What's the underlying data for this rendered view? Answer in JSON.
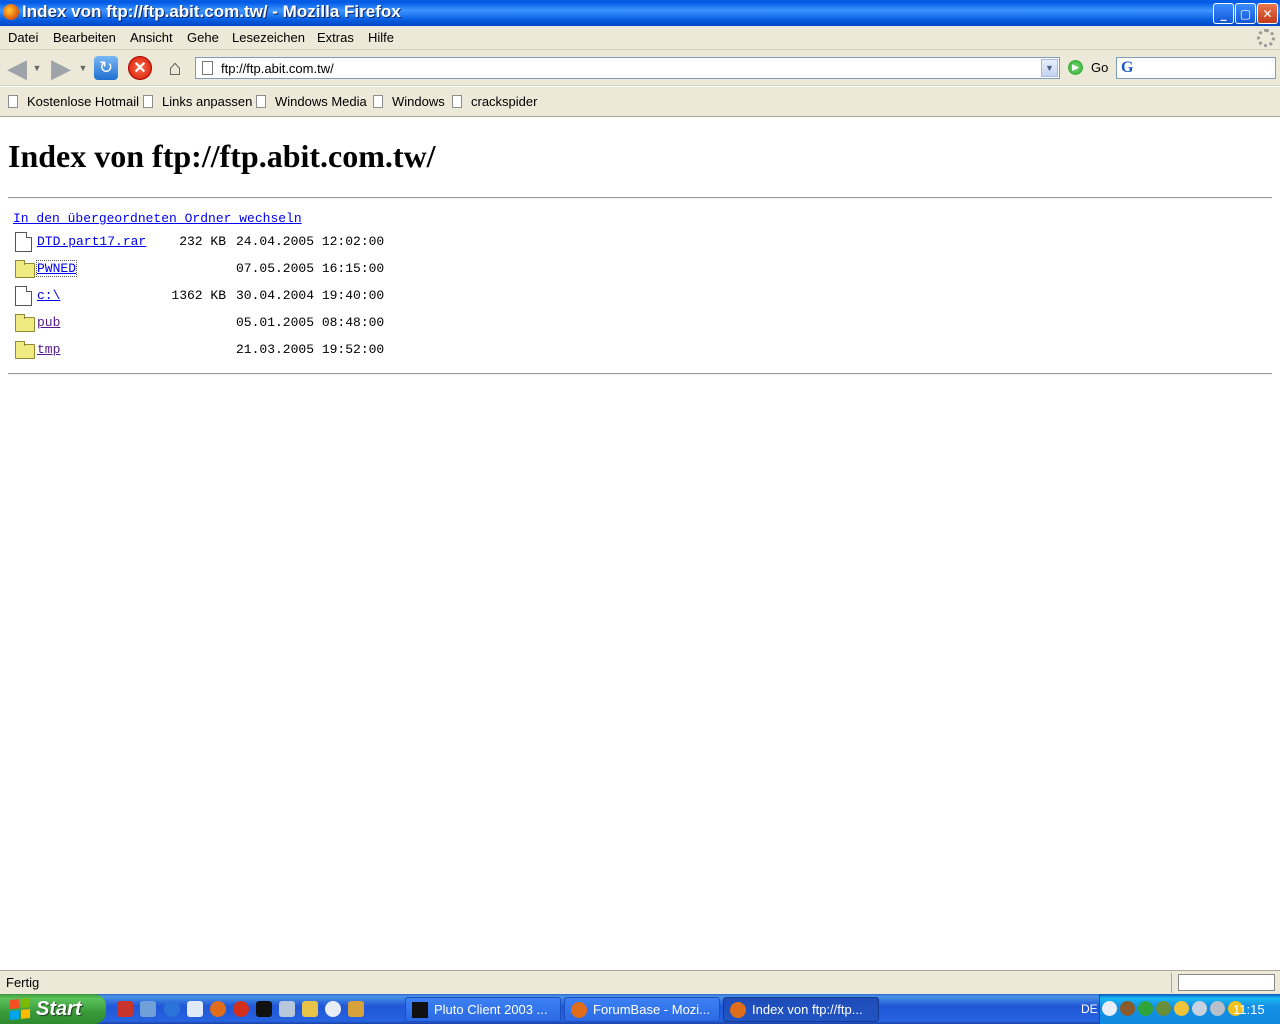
{
  "window": {
    "title": "Index von ftp://ftp.abit.com.tw/ - Mozilla Firefox",
    "controls": {
      "minimize": "_",
      "maximize": "▢",
      "close": "✕"
    }
  },
  "menu": {
    "items": [
      "Datei",
      "Bearbeiten",
      "Ansicht",
      "Gehe",
      "Lesezeichen",
      "Extras",
      "Hilfe"
    ]
  },
  "navbar": {
    "url": "ftp://ftp.abit.com.tw/",
    "go_label": "Go",
    "search_engine_icon": "G",
    "icons": {
      "back": "back-arrow-icon",
      "forward": "forward-arrow-icon",
      "reload": "reload-icon",
      "stop": "stop-icon",
      "home": "home-icon"
    }
  },
  "bookmarks": {
    "items": [
      "Kostenlose Hotmail",
      "Links anpassen",
      "Windows Media",
      "Windows",
      "crackspider"
    ]
  },
  "page": {
    "heading": "Index von ftp://ftp.abit.com.tw/",
    "parent_link": "In den übergeordneten Ordner wechseln",
    "entries": [
      {
        "type": "file",
        "name": "DTD.part17.rar",
        "size": "232 KB",
        "date": "24.04.2005 12:02:00"
      },
      {
        "type": "folder",
        "name": "PWNED",
        "size": "",
        "date": "07.05.2005 16:15:00"
      },
      {
        "type": "file",
        "name": "c:\\",
        "size": "1362 KB",
        "date": "30.04.2004 19:40:00"
      },
      {
        "type": "folder",
        "name": "pub",
        "size": "",
        "date": "05.01.2005 08:48:00"
      },
      {
        "type": "folder",
        "name": "tmp",
        "size": "",
        "date": "21.03.2005 19:52:00"
      }
    ]
  },
  "status": {
    "text": "Fertig"
  },
  "taskbar": {
    "start_label": "Start",
    "tasks": [
      {
        "label": "Pluto Client 2003 ...",
        "active": false
      },
      {
        "label": "ForumBase - Mozi...",
        "active": false
      },
      {
        "label": "Index von ftp://ftp...",
        "active": true
      }
    ],
    "language": "DE",
    "clock": "11:15"
  },
  "colors": {
    "link": "#0000ee",
    "visited_link": "#551a8b",
    "chrome_bg": "#ece9d8",
    "taskbar_blue": "#2157d7",
    "start_green": "#3a9a3a"
  }
}
